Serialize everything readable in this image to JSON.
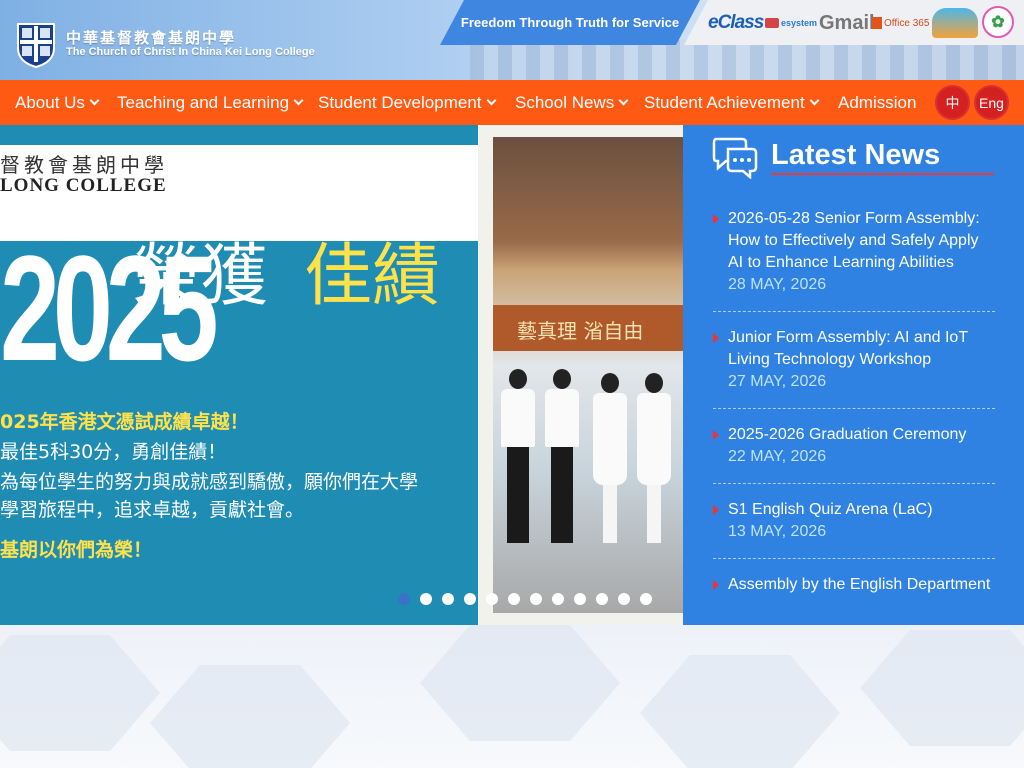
{
  "header": {
    "school_name_zh": "中華基督教會基朗中學",
    "school_name_en": "The Church of Christ In China Kei Long College",
    "motto": "Freedom Through Truth for Service",
    "quick_links": [
      "eClass",
      "esystem",
      "Gmail",
      "Office 365"
    ]
  },
  "nav": {
    "items": [
      {
        "label": "About Us",
        "dropdown": true
      },
      {
        "label": "Teaching and Learning",
        "dropdown": true
      },
      {
        "label": "Student Development",
        "dropdown": true
      },
      {
        "label": "School News",
        "dropdown": true
      },
      {
        "label": "Student Achievement",
        "dropdown": true
      },
      {
        "label": "Admission",
        "dropdown": false
      }
    ],
    "lang_zh": "中",
    "lang_en": "Eng"
  },
  "slider": {
    "poster_zh_name": "督教會基朗中學",
    "poster_en_name": "LONG COLLEGE",
    "poster_year": "2025",
    "poster_title_1": "榮獲",
    "poster_title_2": "佳績",
    "poster_lines": [
      "025年香港文憑試成績卓越！",
      "最佳5科30分，勇創佳績！",
      "為每位學生的努力與成就感到驕傲，願你們在大學",
      "學習旅程中，追求卓越，貢獻社會。",
      "基朗以你們為榮！"
    ],
    "photo_sign": "藝真理  渻自由",
    "dot_count": 12,
    "active_dot": 0
  },
  "news": {
    "title": "Latest News",
    "items": [
      {
        "title": "2026-05-28 Senior Form Assembly: How to Effectively and Safely Apply AI to Enhance Learning Abilities",
        "date": "28 MAY, 2026"
      },
      {
        "title": "Junior Form Assembly: AI and IoT Living Technology Workshop",
        "date": "27 MAY, 2026"
      },
      {
        "title": "2025-2026 Graduation Ceremony",
        "date": "22 MAY, 2026"
      },
      {
        "title": "S1 English Quiz Arena (LaC)",
        "date": "13 MAY, 2026"
      },
      {
        "title": "Assembly by the English Department",
        "date": ""
      }
    ]
  },
  "colors": {
    "nav_bg": "#ff5a14",
    "motto_bg": "#3f86e0",
    "news_bg": "#2f82e2",
    "lang_btn": "#d42020",
    "poster_bg": "#1f8cb3",
    "poster_highlight": "#ffe24a"
  },
  "icons": [
    "school-crest-icon",
    "chevron-down-icon",
    "chat-bubbles-icon",
    "triangle-bullet-icon"
  ]
}
